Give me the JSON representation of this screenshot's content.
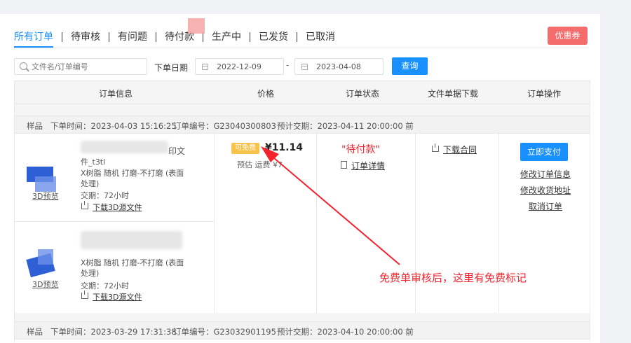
{
  "tabs": [
    {
      "label": "所有订单"
    },
    {
      "label": "待审核"
    },
    {
      "label": "有问题"
    },
    {
      "label": "待付款"
    },
    {
      "label": "生产中"
    },
    {
      "label": "已发货"
    },
    {
      "label": "已取消"
    }
  ],
  "coupon_button": "优惠券",
  "search": {
    "placeholder": "文件名/订单编号"
  },
  "date_filter": {
    "label": "下单日期",
    "start": "2022-12-09",
    "separator": "-",
    "end": "2023-04-08"
  },
  "query_button": "查询",
  "table_headers": {
    "info": "订单信息",
    "price": "价格",
    "status": "订单状态",
    "download": "文件单据下载",
    "ops": "订单操作"
  },
  "orders": [
    {
      "type": "样品",
      "order_time": "下单时间：2023-04-03 15:16:25",
      "order_no": "订单编号：G23040300803",
      "due": "预计交期：2023-04-11 20:00:00 前",
      "items": [
        {
          "name_suffix": "印文",
          "name_line2": "件_t3tl",
          "spec1": "X树脂  随机  打磨-不打磨 (表面",
          "spec2": "处理)",
          "lead": "交期：72小时",
          "preview": "3D预览",
          "download": "下载3D源文件"
        },
        {
          "spec1": "X树脂  随机  打磨-不打磨 (表面",
          "spec2": "处理)",
          "lead": "交期：72小时",
          "preview": "3D预览",
          "download": "下载3D源文件"
        }
      ],
      "free_badge": "可免费",
      "price": "¥11.14",
      "shipping": "预估 运费    ¥7",
      "status": "\"待付款\"",
      "detail_link": "订单详情",
      "contract_link": "下载合同",
      "pay_button": "立即支付",
      "ops": [
        "修改订单信息",
        "修改收货地址",
        "取消订单"
      ]
    },
    {
      "type": "样品",
      "order_time": "下单时间：2023-03-29 17:31:38",
      "order_no": "订单编号：G23032901195",
      "due": "预计交期：2023-04-10 20:00:00 前"
    }
  ],
  "annotation": "免费单审核后，这里有免费标记",
  "colors": {
    "accent": "#1890ff",
    "danger": "#f5222d",
    "coupon": "#f56c6c",
    "badge": "#f7c34b"
  }
}
